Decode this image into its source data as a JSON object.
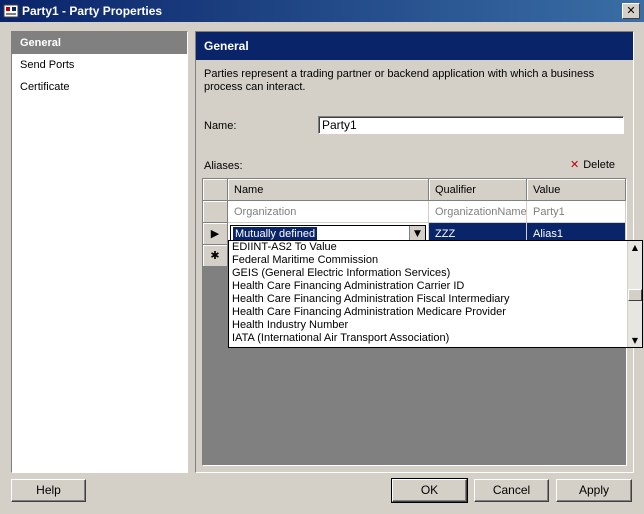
{
  "window": {
    "title": "Party1 - Party Properties",
    "close_glyph": "✕"
  },
  "nav": {
    "items": [
      {
        "label": "General"
      },
      {
        "label": "Send Ports"
      },
      {
        "label": "Certificate"
      }
    ]
  },
  "content": {
    "header": "General",
    "description": "Parties represent a trading partner or backend application with which a business process can interact.",
    "name_label": "Name:",
    "name_value": "Party1",
    "aliases_label": "Aliases:",
    "delete_label": "Delete",
    "grid": {
      "columns": [
        "Name",
        "Qualifier",
        "Value"
      ],
      "rows": [
        {
          "name": "Organization",
          "qualifier": "OrganizationName",
          "value": "Party1"
        },
        {
          "name": "Mutually defined",
          "qualifier": "ZZZ",
          "value": "Alias1"
        }
      ],
      "current_row_glyph": "▶",
      "new_row_glyph": "✱",
      "combo_arrow": "▼"
    },
    "dropdown": {
      "options": [
        "EDIINT-AS2 To Value",
        "Federal Maritime Commission",
        "GEIS (General Electric Information Services)",
        "Health Care Financing Administration Carrier ID",
        "Health Care Financing Administration Fiscal Intermediary",
        "Health Care Financing Administration Medicare Provider",
        "Health Industry Number",
        "IATA (International Air Transport Association)"
      ],
      "scroll_up": "▲",
      "scroll_down": "▼"
    }
  },
  "buttons": {
    "help": "Help",
    "ok": "OK",
    "cancel": "Cancel",
    "apply": "Apply"
  },
  "colors": {
    "title_bar": "#0a246a",
    "selection": "#0a246a",
    "nav_selected": "#808080",
    "face": "#d4d0c8",
    "delete_icon": "#c00000"
  }
}
